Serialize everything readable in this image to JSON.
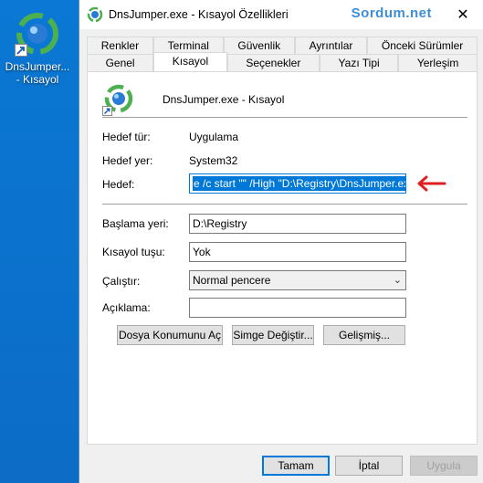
{
  "desktop": {
    "icon_label_line1": "DnsJumper...",
    "icon_label_line2": "- Kısayol"
  },
  "window": {
    "title": "DnsJumper.exe - Kısayol Özellikleri",
    "watermark": "Sordum.net",
    "close_glyph": "✕"
  },
  "tabs": {
    "back_row": [
      "Renkler",
      "Terminal",
      "Güvenlik",
      "Ayrıntılar",
      "Önceki Sürümler"
    ],
    "front_row": [
      "Genel",
      "Kısayol",
      "Seçenekler",
      "Yazı Tipi",
      "Yerleşim"
    ],
    "active": "Kısayol"
  },
  "shortcut": {
    "name": "DnsJumper.exe - Kısayol",
    "target_type_label": "Hedef tür:",
    "target_type_value": "Uygulama",
    "target_location_label": "Hedef yer:",
    "target_location_value": "System32",
    "target_label": "Hedef:",
    "target_value": "e /c start \"\" /High \"D:\\Registry\\DnsJumper.exe\"",
    "start_in_label": "Başlama yeri:",
    "start_in_value": "D:\\Registry",
    "shortcut_key_label": "Kısayol tuşu:",
    "shortcut_key_value": "Yok",
    "run_label": "Çalıştır:",
    "run_value": "Normal pencere",
    "comment_label": "Açıklama:",
    "comment_value": ""
  },
  "buttons": {
    "open_location": "Dosya Konumunu Aç",
    "change_icon": "Simge Değiştir...",
    "advanced": "Gelişmiş...",
    "ok": "Tamam",
    "cancel": "İptal",
    "apply": "Uygula"
  },
  "colors": {
    "desktop_bg": "#0a78d4",
    "accent": "#0078d7",
    "watermark": "#3e8ed6",
    "annotation_arrow": "#e02020"
  },
  "icons": [
    "dnsjumper-app-icon",
    "shortcut-arrow-icon",
    "close-icon",
    "chevron-down-icon",
    "red-arrow-icon"
  ]
}
